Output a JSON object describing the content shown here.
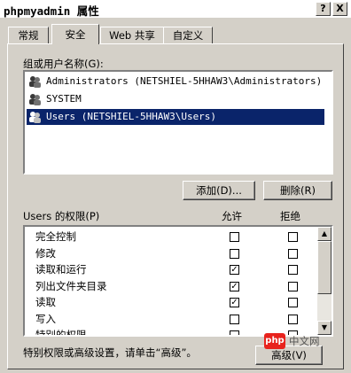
{
  "window": {
    "title": "phpmyadmin 属性",
    "help_label": "?",
    "close_label": "X"
  },
  "tabs": [
    {
      "label": "常规",
      "active": false
    },
    {
      "label": "安全",
      "active": true
    },
    {
      "label": "Web 共享",
      "active": false
    },
    {
      "label": "自定义",
      "active": false
    }
  ],
  "groups": {
    "label": "组或用户名称(G):",
    "items": [
      {
        "name": "Administrators (NETSHIEL-5HHAW3\\Administrators)",
        "selected": false
      },
      {
        "name": "SYSTEM",
        "selected": false
      },
      {
        "name": "Users (NETSHIEL-5HHAW3\\Users)",
        "selected": true
      }
    ],
    "add_label": "添加(D)...",
    "remove_label": "删除(R)"
  },
  "permissions": {
    "label": "Users 的权限(P)",
    "allow_header": "允许",
    "deny_header": "拒绝",
    "rows": [
      {
        "name": "完全控制",
        "allow": false,
        "deny": false
      },
      {
        "name": "修改",
        "allow": false,
        "deny": false
      },
      {
        "name": "读取和运行",
        "allow": true,
        "deny": false
      },
      {
        "name": "列出文件夹目录",
        "allow": true,
        "deny": false
      },
      {
        "name": "读取",
        "allow": true,
        "deny": false
      },
      {
        "name": "写入",
        "allow": false,
        "deny": false
      },
      {
        "name": "特别的权限",
        "allow": false,
        "deny": false
      }
    ]
  },
  "advanced": {
    "hint": "特别权限或高级设置，请单击“高级”。",
    "button_label": "高级(V)"
  },
  "watermark": {
    "logo": "php",
    "text": "中文网"
  },
  "colors": {
    "selection": "#0a246a",
    "face": "#d4d0c8",
    "watermark_red": "#e8231d"
  }
}
